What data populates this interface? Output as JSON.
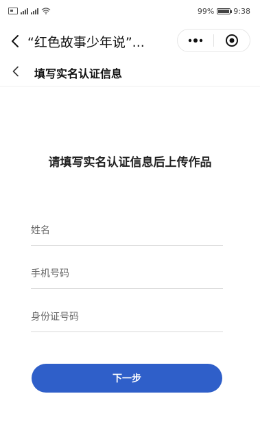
{
  "status_bar": {
    "battery": "99%",
    "time": "9:38",
    "icons": [
      "sim-icon",
      "signal-icon",
      "wifi-icon",
      "battery-icon"
    ]
  },
  "title_bar": {
    "title": "“红色故事少年说”...",
    "icons": [
      "back-chevron-icon",
      "more-dots-icon",
      "close-target-icon"
    ]
  },
  "page_header": {
    "title": "填写实名认证信息",
    "icons": [
      "back-chevron-icon"
    ]
  },
  "form": {
    "heading": "请填写实名认证信息后上传作品",
    "fields": [
      {
        "placeholder": "姓名",
        "value": ""
      },
      {
        "placeholder": "手机号码",
        "value": ""
      },
      {
        "placeholder": "身份证号码",
        "value": ""
      }
    ],
    "submit_label": "下一步"
  },
  "colors": {
    "primary_button": "#2f5fc9",
    "text": "#222222",
    "divider": "#d8d8d8"
  }
}
